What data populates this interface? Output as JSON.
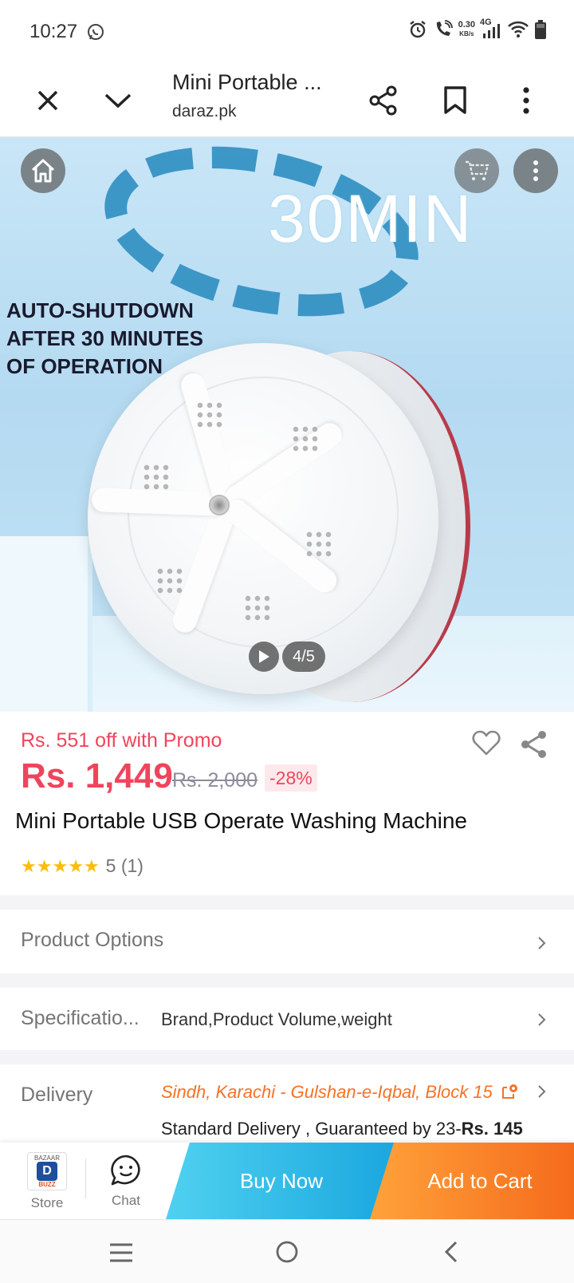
{
  "status_bar": {
    "time": "10:27",
    "net_speed_value": "0.30",
    "net_speed_unit": "KB/s",
    "network_type": "4G"
  },
  "toolbar": {
    "title": "Mini Portable ...",
    "url": "daraz.pk"
  },
  "hero": {
    "badge_text": "30MIN",
    "caption_lines": [
      "AUTO-SHUTDOWN",
      "AFTER 30 MINUTES",
      "OF OPERATION"
    ],
    "image_counter": "4/5"
  },
  "product": {
    "promo_text": "Rs. 551 off with Promo",
    "price": "Rs. 1,449",
    "original_price": "Rs. 2,000",
    "discount": "-28%",
    "title": "Mini Portable USB Operate Washing Machine",
    "rating_stars": 5,
    "rating_text": "5 (1)"
  },
  "rows": {
    "product_options": {
      "label": "Product Options"
    },
    "specifications": {
      "label": "Specificatio...",
      "value": "Brand,Product Volume,weight"
    },
    "delivery": {
      "label": "Delivery",
      "address": "Sindh, Karachi - Gulshan-e-Iqbal, Block 15",
      "standard": "Standard Delivery , Guaranteed by 23-",
      "fee": "Rs. 145"
    }
  },
  "action_bar": {
    "store_label": "Store",
    "store_logo_top": "BAZAAR",
    "store_logo_letter": "D",
    "store_logo_bottom": "BUZZ",
    "chat_label": "Chat",
    "buy_now": "Buy Now",
    "add_to_cart": "Add to Cart"
  },
  "colors": {
    "price": "#f0445c",
    "delivery_address": "#f57224",
    "buy_now": "#1aa7df",
    "add_to_cart": "#f56b1c",
    "star": "#fbbc0a"
  }
}
